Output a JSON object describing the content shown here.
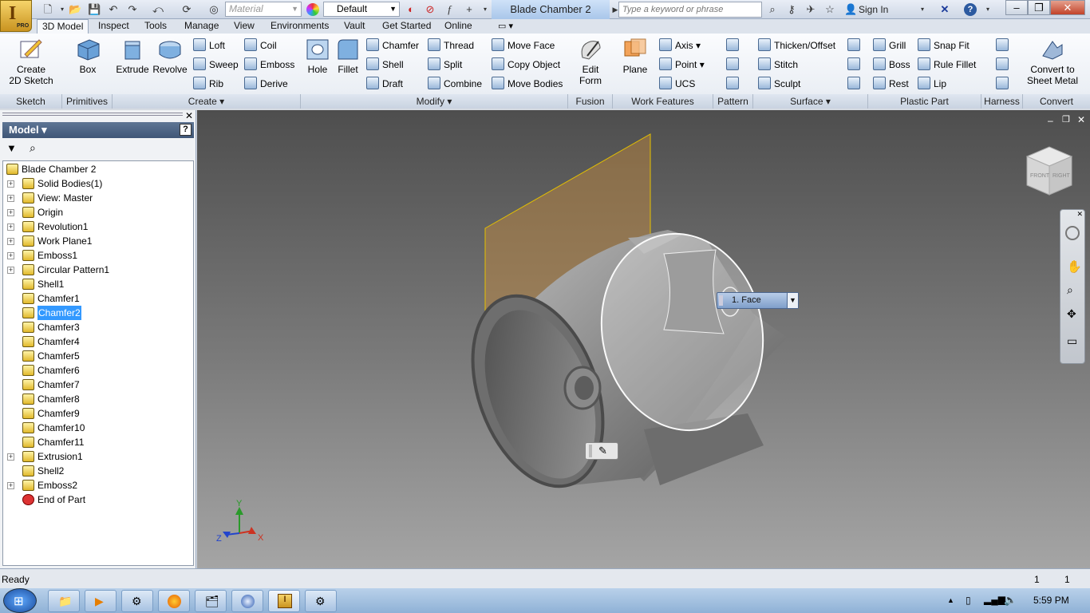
{
  "app": {
    "title": "Blade Chamber 2",
    "pro_label": "PRO"
  },
  "qat": {
    "material_placeholder": "Material",
    "appearance_value": "Default",
    "search_placeholder": "Type a keyword or phrase",
    "sign_in": "Sign In"
  },
  "tabs": [
    "3D Model",
    "Inspect",
    "Tools",
    "Manage",
    "View",
    "Environments",
    "Vault",
    "Get Started",
    "Online"
  ],
  "ribbon": {
    "sketch": {
      "create_sketch": "Create\n2D Sketch",
      "panel": "Sketch"
    },
    "primitives": {
      "box": "Box",
      "panel": "Primitives"
    },
    "create": {
      "extrude": "Extrude",
      "revolve": "Revolve",
      "loft": "Loft",
      "sweep": "Sweep",
      "rib": "Rib",
      "coil": "Coil",
      "emboss": "Emboss",
      "derive": "Derive",
      "panel": "Create"
    },
    "modify": {
      "hole": "Hole",
      "fillet": "Fillet",
      "chamfer": "Chamfer",
      "shell": "Shell",
      "draft": "Draft",
      "thread": "Thread",
      "split": "Split",
      "combine": "Combine",
      "move_face": "Move Face",
      "copy_object": "Copy Object",
      "move_bodies": "Move Bodies",
      "panel": "Modify"
    },
    "fusion": {
      "edit_form": "Edit\nForm",
      "panel": "Fusion"
    },
    "work_features": {
      "plane": "Plane",
      "axis": "Axis",
      "point": "Point",
      "ucs": "UCS",
      "panel": "Work Features"
    },
    "pattern": {
      "panel": "Pattern"
    },
    "surface": {
      "thicken": "Thicken/Offset",
      "stitch": "Stitch",
      "sculpt": "Sculpt",
      "panel": "Surface"
    },
    "plastic": {
      "grill": "Grill",
      "boss": "Boss",
      "rest": "Rest",
      "snap_fit": "Snap Fit",
      "rule_fillet": "Rule Fillet",
      "lip": "Lip",
      "panel": "Plastic Part"
    },
    "harness": {
      "panel": "Harness"
    },
    "convert": {
      "convert_sheet_metal": "Convert to\nSheet Metal",
      "panel": "Convert"
    }
  },
  "browser": {
    "title": "Model",
    "items": [
      {
        "label": "Blade Chamber 2",
        "expand": false,
        "indent": 0,
        "selected": false
      },
      {
        "label": "Solid Bodies(1)",
        "expand": true,
        "indent": 1,
        "selected": false
      },
      {
        "label": "View: Master",
        "expand": true,
        "indent": 1,
        "selected": false
      },
      {
        "label": "Origin",
        "expand": true,
        "indent": 1,
        "selected": false
      },
      {
        "label": "Revolution1",
        "expand": true,
        "indent": 1,
        "selected": false
      },
      {
        "label": "Work Plane1",
        "expand": true,
        "indent": 1,
        "selected": false
      },
      {
        "label": "Emboss1",
        "expand": true,
        "indent": 1,
        "selected": false
      },
      {
        "label": "Circular Pattern1",
        "expand": true,
        "indent": 1,
        "selected": false
      },
      {
        "label": "Shell1",
        "expand": false,
        "indent": 1,
        "selected": false
      },
      {
        "label": "Chamfer1",
        "expand": false,
        "indent": 1,
        "selected": false
      },
      {
        "label": "Chamfer2",
        "expand": false,
        "indent": 1,
        "selected": true
      },
      {
        "label": "Chamfer3",
        "expand": false,
        "indent": 1,
        "selected": false
      },
      {
        "label": "Chamfer4",
        "expand": false,
        "indent": 1,
        "selected": false
      },
      {
        "label": "Chamfer5",
        "expand": false,
        "indent": 1,
        "selected": false
      },
      {
        "label": "Chamfer6",
        "expand": false,
        "indent": 1,
        "selected": false
      },
      {
        "label": "Chamfer7",
        "expand": false,
        "indent": 1,
        "selected": false
      },
      {
        "label": "Chamfer8",
        "expand": false,
        "indent": 1,
        "selected": false
      },
      {
        "label": "Chamfer9",
        "expand": false,
        "indent": 1,
        "selected": false
      },
      {
        "label": "Chamfer10",
        "expand": false,
        "indent": 1,
        "selected": false
      },
      {
        "label": "Chamfer11",
        "expand": false,
        "indent": 1,
        "selected": false
      },
      {
        "label": "Extrusion1",
        "expand": true,
        "indent": 1,
        "selected": false
      },
      {
        "label": "Shell2",
        "expand": false,
        "indent": 1,
        "selected": false
      },
      {
        "label": "Emboss2",
        "expand": true,
        "indent": 1,
        "selected": false
      },
      {
        "label": "End of Part",
        "expand": false,
        "indent": 1,
        "selected": false
      }
    ]
  },
  "viewport": {
    "face_popup": "1. Face",
    "viewcube_front": "FRONT",
    "viewcube_right": "RIGHT",
    "axis_x": "X",
    "axis_y": "Y",
    "axis_z": "Z"
  },
  "status": {
    "text": "Ready",
    "count1": "1",
    "count2": "1"
  },
  "taskbar": {
    "time": "5:59 PM"
  },
  "colors": {
    "accent": "#3399ff",
    "work_plane": "#e4c000"
  }
}
